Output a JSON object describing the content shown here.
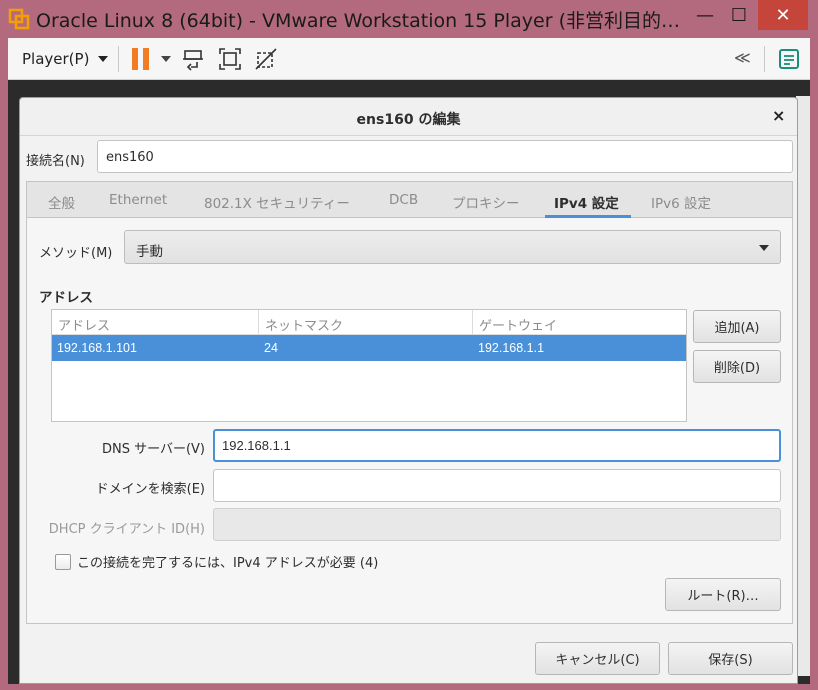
{
  "window": {
    "title": "Oracle Linux 8 (64bit) - VMware Workstation 15 Player (非営利目的…",
    "minimize": "—",
    "maximize": "☐",
    "close": "✕"
  },
  "toolbar": {
    "player_menu": "Player(P)",
    "icons": [
      "pause-icon",
      "send-ctrl-alt-del-icon",
      "fullscreen-icon",
      "unity-icon",
      "collapse-icon",
      "notes-icon"
    ],
    "collapse_glyph": "≪",
    "accent_color": "#f07d24"
  },
  "dialog": {
    "title": "ens160 の編集",
    "close": "×",
    "connection_name_label": "接続名(N)",
    "connection_name_value": "ens160",
    "tabs": [
      {
        "label": "全般"
      },
      {
        "label": "Ethernet"
      },
      {
        "label": "802.1X セキュリティー"
      },
      {
        "label": "DCB"
      },
      {
        "label": "プロキシー"
      },
      {
        "label": "IPv4 設定",
        "active": true
      },
      {
        "label": "IPv6 設定"
      }
    ],
    "method_label": "メソッド(M)",
    "method_value": "手動",
    "address_heading": "アドレス",
    "address_table": {
      "columns": [
        "アドレス",
        "ネットマスク",
        "ゲートウェイ"
      ],
      "rows": [
        {
          "address": "192.168.1.101",
          "netmask": "24",
          "gateway": "192.168.1.1",
          "selected": true
        }
      ]
    },
    "add_button": "追加(A)",
    "delete_button": "削除(D)",
    "dns_label": "DNS サーバー(V)",
    "dns_value": "192.168.1.1",
    "search_domain_label": "ドメインを検索(E)",
    "search_domain_value": "",
    "dhcp_client_id_label": "DHCP クライアント ID(H)",
    "dhcp_client_id_value": "",
    "require_ipv4_label": "この接続を完了するには、IPv4 アドレスが必要 (4)",
    "require_ipv4_checked": false,
    "routes_button": "ルート(R)…",
    "cancel_button": "キャンセル(C)",
    "save_button": "保存(S)",
    "selection_color": "#4a90d9"
  }
}
